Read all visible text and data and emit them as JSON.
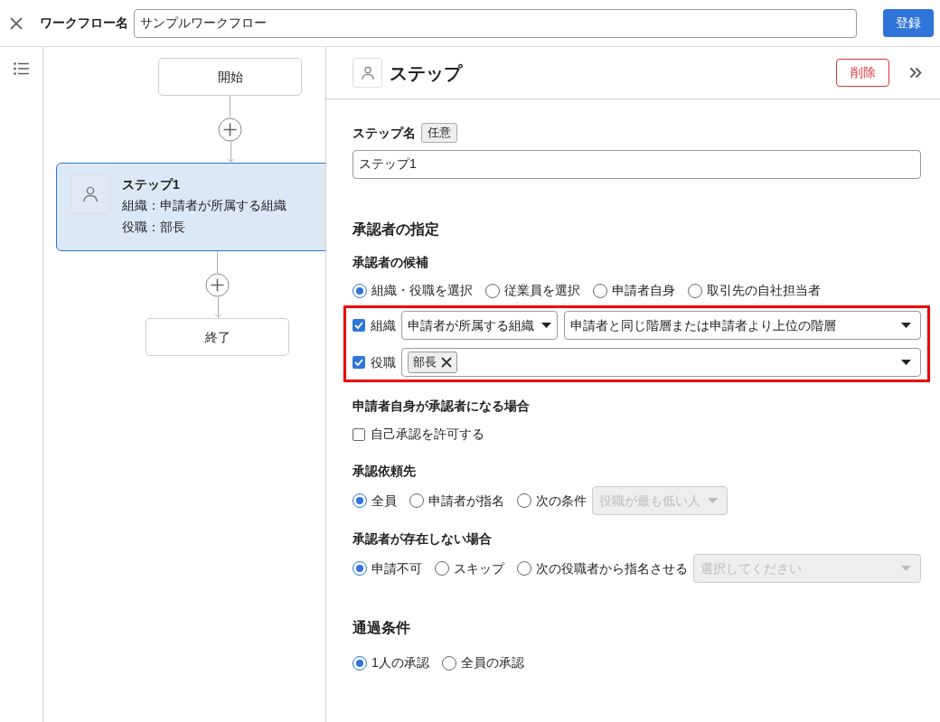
{
  "header": {
    "label": "ワークフロー名",
    "value": "サンプルワークフロー",
    "submit": "登録"
  },
  "flow": {
    "start": "開始",
    "end": "終了",
    "step": {
      "title": "ステップ1",
      "lines": [
        "組織：申請者が所属する組織",
        "役職：部長"
      ],
      "selected": true
    }
  },
  "panel": {
    "title": "ステップ",
    "delete": "削除",
    "step_name": {
      "label": "ステップ名",
      "badge": "任意",
      "value": "ステップ1"
    },
    "section_title": "承認者の指定",
    "candidates": {
      "label": "承認者の候補",
      "options": [
        {
          "label": "組織・役職を選択",
          "selected": true
        },
        {
          "label": "従業員を選択",
          "selected": false
        },
        {
          "label": "申請者自身",
          "selected": false
        },
        {
          "label": "取引先の自社担当者",
          "selected": false
        }
      ],
      "org": {
        "label": "組織",
        "checked": true,
        "select1": "申請者が所属する組織",
        "select2": "申請者と同じ階層または申請者より上位の階層"
      },
      "role": {
        "label": "役職",
        "checked": true,
        "tags": [
          "部長"
        ]
      }
    },
    "self": {
      "label": "申請者自身が承認者になる場合",
      "option": {
        "label": "自己承認を許可する",
        "checked": false
      }
    },
    "request": {
      "label": "承認依頼先",
      "options": [
        {
          "label": "全員",
          "selected": true
        },
        {
          "label": "申請者が指名",
          "selected": false
        },
        {
          "label": "次の条件",
          "selected": false
        }
      ],
      "select": {
        "value": "役職が最も低い人",
        "disabled": true
      }
    },
    "none": {
      "label": "承認者が存在しない場合",
      "options": [
        {
          "label": "申請不可",
          "selected": true
        },
        {
          "label": "スキップ",
          "selected": false
        },
        {
          "label": "次の役職者から指名させる",
          "selected": false
        }
      ],
      "select": {
        "placeholder": "選択してください",
        "disabled": true
      }
    },
    "pass_title": "通過条件",
    "pass": {
      "options": [
        {
          "label": "1人の承認",
          "selected": true
        },
        {
          "label": "全員の承認",
          "selected": false
        }
      ]
    }
  }
}
